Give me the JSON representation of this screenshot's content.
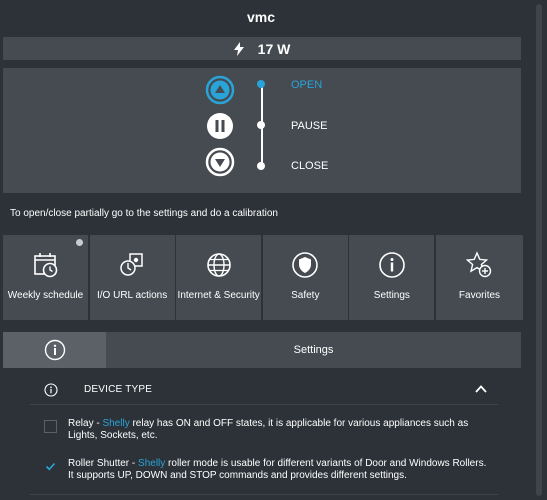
{
  "device": {
    "name": "vmc"
  },
  "power": {
    "value": "17 W",
    "icon": "bolt-icon"
  },
  "roller": {
    "open_label": "OPEN",
    "pause_label": "PAUSE",
    "close_label": "CLOSE",
    "active": "open"
  },
  "hint": "To open/close partially go to the settings and do a calibration",
  "tiles": [
    {
      "label": "Weekly schedule",
      "icon": "calendar-clock-icon",
      "badge": true
    },
    {
      "label": "I/O URL actions",
      "icon": "url-actions-icon"
    },
    {
      "label": "Internet & Security",
      "icon": "globe-icon"
    },
    {
      "label": "Safety",
      "icon": "shield-icon"
    },
    {
      "label": "Settings",
      "icon": "info-icon"
    },
    {
      "label": "Favorites",
      "icon": "star-add-icon"
    }
  ],
  "tabs": {
    "settings_label": "Settings",
    "info_icon": "info-icon"
  },
  "section": {
    "title": "DEVICE TYPE",
    "expanded": true
  },
  "options": [
    {
      "checked": false,
      "prefix": "Relay - ",
      "brand": "Shelly",
      "text": " relay has ON and OFF states, it is applicable for various appliances such as Lights, Sockets, etc."
    },
    {
      "checked": true,
      "prefix": "Roller Shutter - ",
      "brand": "Shelly",
      "text": " roller mode is usable for different variants of Door and Windows Rollers. It supports UP, DOWN and STOP commands and provides different settings."
    }
  ],
  "colors": {
    "accent": "#29a4d9",
    "panel": "#454b51",
    "background": "#2c3238"
  }
}
